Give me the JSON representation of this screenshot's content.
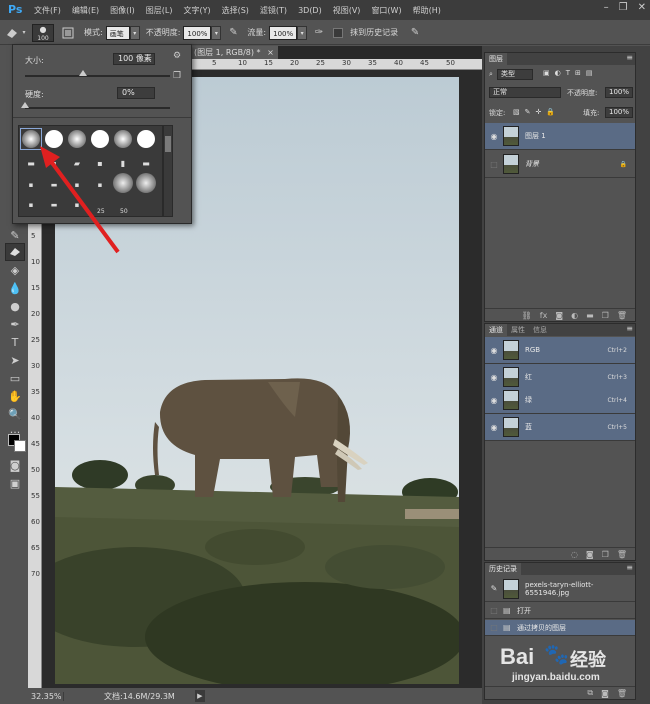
{
  "app": {
    "logo": "Ps"
  },
  "menu": [
    "文件(F)",
    "编辑(E)",
    "图像(I)",
    "图层(L)",
    "文字(Y)",
    "选择(S)",
    "滤镜(T)",
    "3D(D)",
    "视图(V)",
    "窗口(W)",
    "帮助(H)"
  ],
  "window_controls": {
    "minimize": "–",
    "restore": "❐",
    "close": "✕"
  },
  "options": {
    "brush_size": "100",
    "mode_label": "模式:",
    "mode_value": "画笔",
    "opacity_label": "不透明度:",
    "opacity_value": "100%",
    "flow_label": "流量:",
    "flow_value": "100%",
    "history_label": "抹到历史记录"
  },
  "brush_panel": {
    "size_label": "大小:",
    "size_value": "100 像素",
    "hardness_label": "硬度:",
    "hardness_value": "0%",
    "size_fraction": 0.4,
    "hardness_fraction": 0.0,
    "preset_labels": [
      "25",
      "50"
    ]
  },
  "document": {
    "tab_title": "(图层 1, RGB/8) *",
    "tab_close": "×",
    "zoom": "32.35%",
    "doc_info": "文档:14.6M/29.3M",
    "ruler_top": [
      "5",
      "10",
      "15",
      "20",
      "25",
      "30",
      "35",
      "40",
      "45",
      "50"
    ],
    "ruler_left": [
      "5",
      "10",
      "15",
      "20",
      "25",
      "30",
      "35",
      "40",
      "45",
      "50",
      "55",
      "60",
      "65",
      "70"
    ]
  },
  "layers_panel": {
    "tab": "图层",
    "filter_label": "类型",
    "blend_mode": "正常",
    "opacity_label": "不透明度:",
    "opacity_value": "100%",
    "lock_label": "锁定:",
    "fill_label": "填充:",
    "fill_value": "100%",
    "layers": [
      {
        "name": "图层 1",
        "selected": true
      },
      {
        "name": "背景",
        "selected": false
      }
    ]
  },
  "channels_panel": {
    "tabs": [
      "通道",
      "属性",
      "信息"
    ],
    "channels": [
      {
        "name": "RGB",
        "shortcut": "Ctrl+2"
      },
      {
        "name": "红",
        "shortcut": "Ctrl+3"
      },
      {
        "name": "绿",
        "shortcut": "Ctrl+4"
      },
      {
        "name": "蓝",
        "shortcut": "Ctrl+5"
      }
    ]
  },
  "history_panel": {
    "tab": "历史记录",
    "snapshot": "pexels-taryn-elliott-6551946.jpg",
    "items": [
      {
        "name": "打开",
        "selected": false
      },
      {
        "name": "通过拷贝的图层",
        "selected": true
      }
    ]
  },
  "watermark": {
    "brand": "Bai",
    "brand2": "经验",
    "url": "jingyan.baidu.com"
  },
  "colors": {
    "panel_bg": "#535353",
    "dark_bg": "#3c3c3c",
    "selection": "#5a6b85",
    "accent_arrow": "#e02020",
    "ps_blue": "#3fa9f5"
  }
}
